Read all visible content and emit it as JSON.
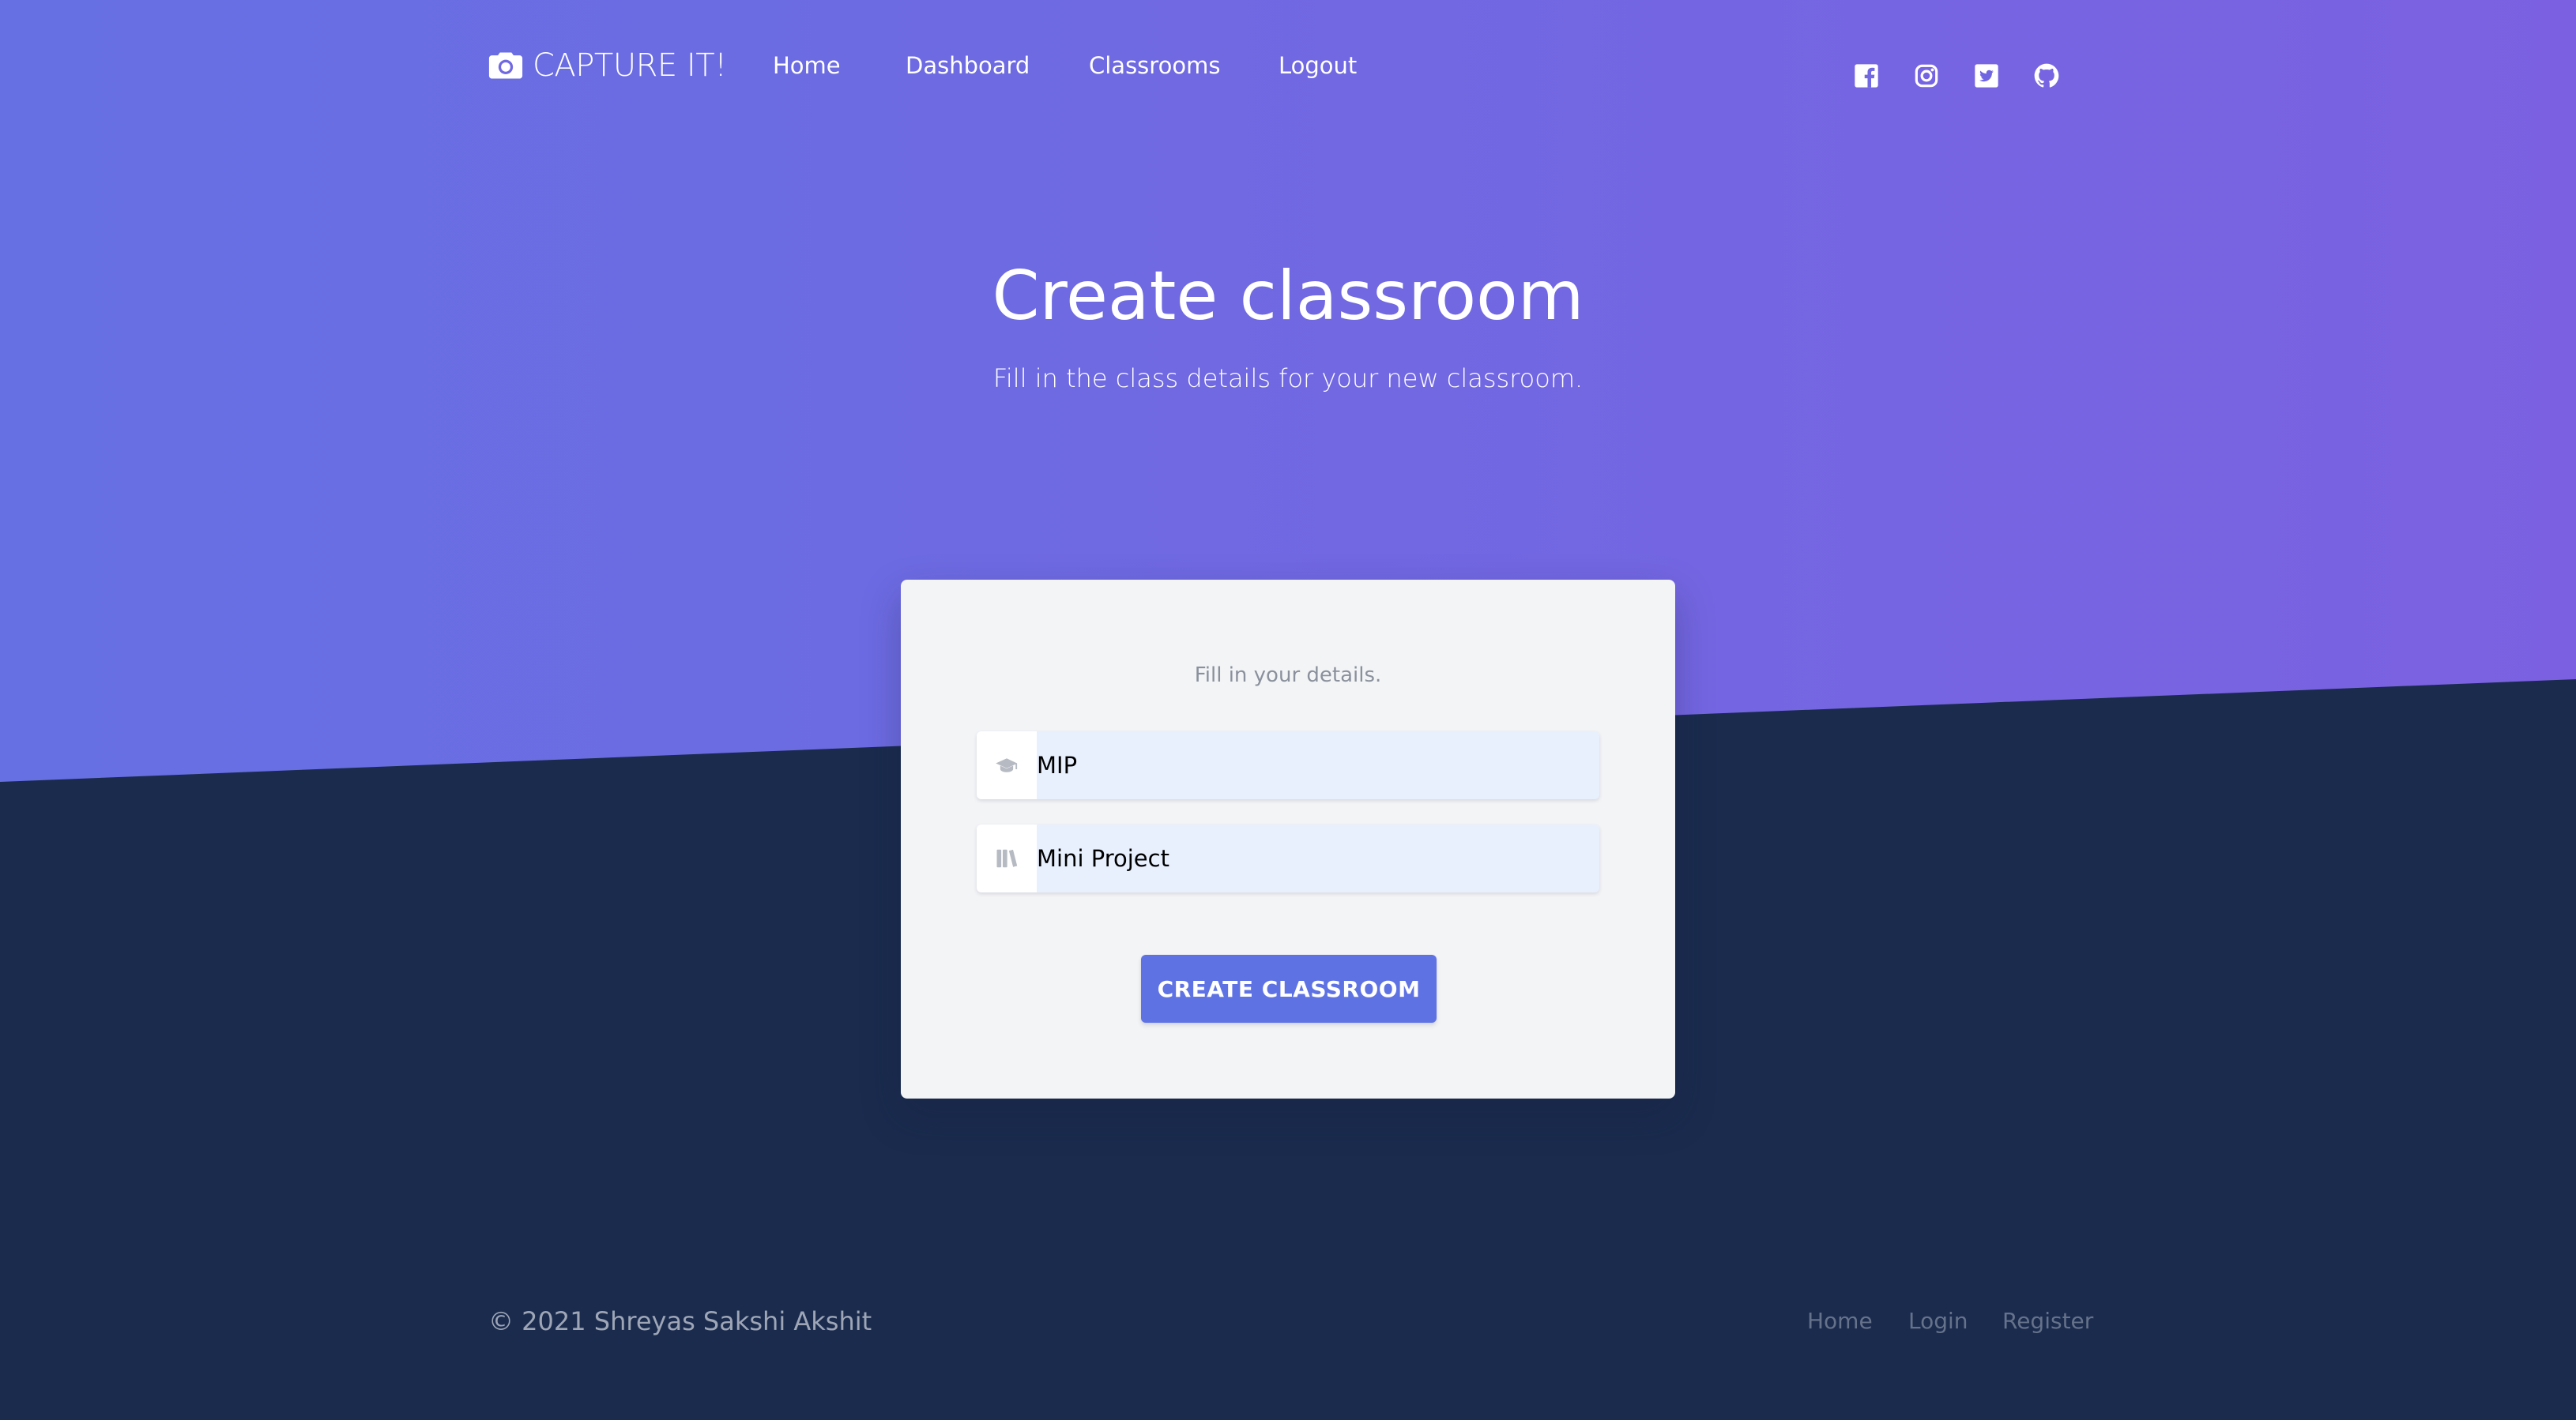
{
  "nav": {
    "brand": "CAPTURE IT!",
    "brand_icon": "camera-icon",
    "links": [
      "Home",
      "Dashboard",
      "Classrooms",
      "Logout"
    ],
    "social_icons": [
      "facebook-icon",
      "instagram-icon",
      "twitter-icon",
      "github-icon"
    ]
  },
  "hero": {
    "title": "Create classroom",
    "subtitle": "Fill in the class details for your new classroom."
  },
  "form": {
    "note": "Fill in your details.",
    "fields": [
      {
        "icon": "graduation-cap-icon",
        "value": "MIP"
      },
      {
        "icon": "books-icon",
        "value": "Mini Project"
      }
    ],
    "submit_label": "CREATE CLASSROOM"
  },
  "footer": {
    "copyright": "© 2021 Shreyas Sakshi Akshit",
    "links": [
      "Home",
      "Login",
      "Register"
    ]
  },
  "colors": {
    "gradient_start": "#6670e3",
    "gradient_end": "#7b61e1",
    "dark_background": "#1a2b4e",
    "card_background": "#f3f4f6",
    "input_background": "#e8f0fe",
    "button": "#5e72e4",
    "footer_link": "#66728a"
  }
}
